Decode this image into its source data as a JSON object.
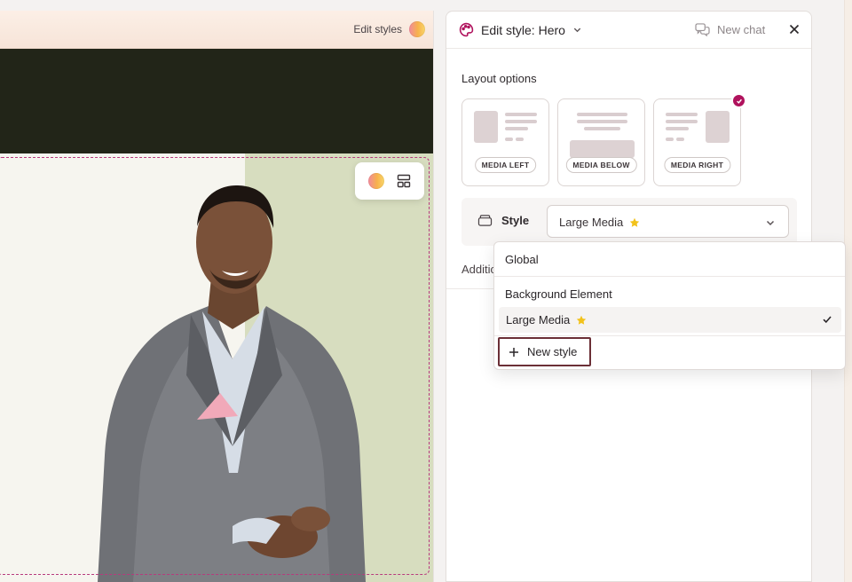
{
  "canvas": {
    "toolbar": {
      "edit_styles_label": "Edit styles"
    },
    "hero_toolbar": {
      "icons": [
        "color-palette-icon",
        "layout-icon"
      ]
    }
  },
  "panel": {
    "title": "Edit style: Hero",
    "new_chat_label": "New chat",
    "layout_section_label": "Layout options",
    "layout_options": [
      {
        "label": "MEDIA LEFT",
        "selected": false
      },
      {
        "label": "MEDIA BELOW",
        "selected": false
      },
      {
        "label": "MEDIA RIGHT",
        "selected": true
      }
    ],
    "style_label": "Style",
    "style_value": "Large Media",
    "additional_label": "Additio"
  },
  "dropdown": {
    "options": [
      {
        "label": "Global"
      },
      {
        "label": "Background Element"
      },
      {
        "label": "Large Media",
        "starred": true,
        "selected": true
      }
    ],
    "new_style_label": "New style"
  },
  "colors": {
    "accent": "#b0125d",
    "hero_outline": "#b73a7d",
    "dark_band": "#222518",
    "hero_green": "#d7ddbf",
    "star": "#f2c21b",
    "new_style_border": "#6b2f36"
  }
}
